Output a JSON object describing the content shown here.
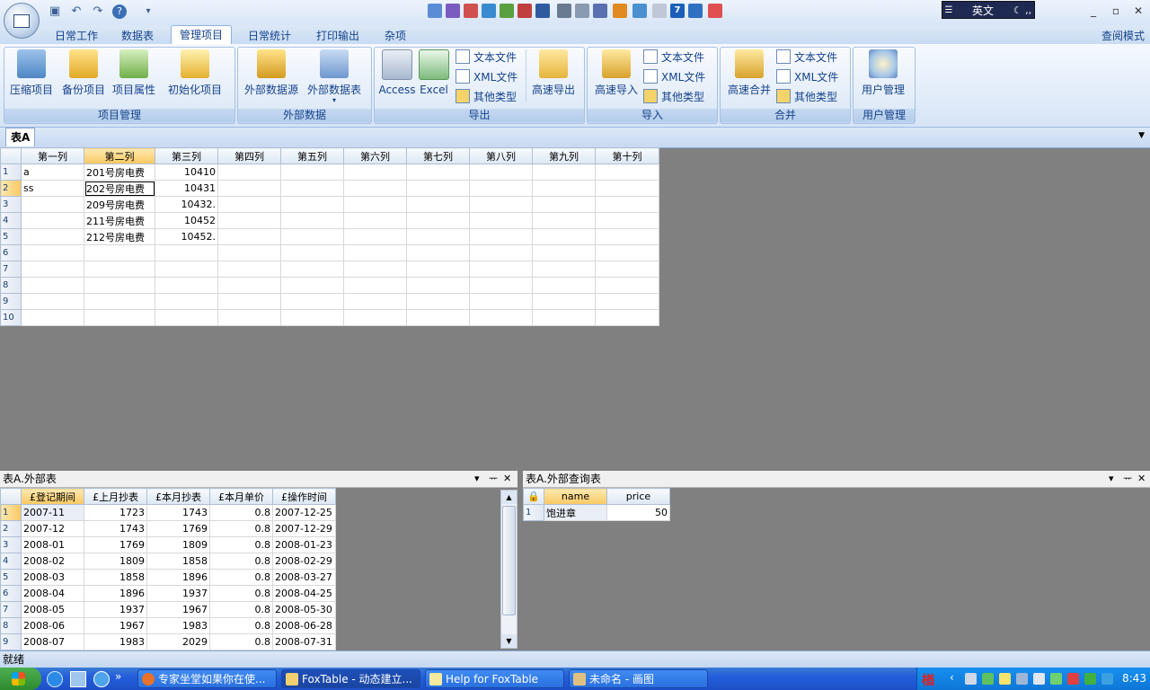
{
  "app": {
    "tabs": [
      "日常工作",
      "数据表",
      "管理项目",
      "日常统计",
      "打印输出",
      "杂项"
    ],
    "active_tab": "管理项目",
    "view_mode": "查阅模式",
    "ime_label": "英文"
  },
  "ribbon": {
    "groups": [
      {
        "label": "项目管理",
        "buttons": [
          "压缩项目",
          "备份项目",
          "项目属性",
          "初始化项目"
        ]
      },
      {
        "label": "外部数据",
        "buttons": [
          "外部数据源",
          "外部数据表"
        ]
      },
      {
        "label": "导出",
        "buttons": [
          "Access",
          "Excel",
          "高速导出"
        ],
        "small": [
          "文本文件",
          "XML文件",
          "其他类型"
        ]
      },
      {
        "label": "导入",
        "buttons": [
          "高速导入"
        ],
        "small": [
          "文本文件",
          "XML文件",
          "其他类型"
        ]
      },
      {
        "label": "合并",
        "buttons": [
          "高速合并"
        ],
        "small": [
          "文本文件",
          "XML文件",
          "其他类型"
        ]
      },
      {
        "label": "用户管理",
        "buttons": [
          "用户管理"
        ]
      }
    ]
  },
  "doc_tab": "表A",
  "main_grid": {
    "columns": [
      "第一列",
      "第二列",
      "第三列",
      "第四列",
      "第五列",
      "第六列",
      "第七列",
      "第八列",
      "第九列",
      "第十列"
    ],
    "rows": [
      [
        "1",
        "a",
        "201号房电费",
        "10410"
      ],
      [
        "2",
        "ss",
        "202号房电费",
        "10431"
      ],
      [
        "3",
        "",
        "209号房电费",
        "10432."
      ],
      [
        "4",
        "",
        "211号房电费",
        "10452"
      ],
      [
        "5",
        "",
        "212号房电费",
        "10452."
      ],
      [
        "6",
        "",
        "",
        ""
      ],
      [
        "7",
        "",
        "",
        ""
      ],
      [
        "8",
        "",
        "",
        ""
      ],
      [
        "9",
        "",
        "",
        ""
      ],
      [
        "10",
        "",
        "",
        ""
      ]
    ]
  },
  "left_panel": {
    "title": "表A.外部表",
    "columns": [
      "£登记期间",
      "£上月抄表",
      "£本月抄表",
      "£本月单价",
      "£操作时间"
    ],
    "rows": [
      [
        "1",
        "2007-11",
        "1723",
        "1743",
        "0.8",
        "2007-12-25"
      ],
      [
        "2",
        "2007-12",
        "1743",
        "1769",
        "0.8",
        "2007-12-29"
      ],
      [
        "3",
        "2008-01",
        "1769",
        "1809",
        "0.8",
        "2008-01-23"
      ],
      [
        "4",
        "2008-02",
        "1809",
        "1858",
        "0.8",
        "2008-02-29"
      ],
      [
        "5",
        "2008-03",
        "1858",
        "1896",
        "0.8",
        "2008-03-27"
      ],
      [
        "6",
        "2008-04",
        "1896",
        "1937",
        "0.8",
        "2008-04-25"
      ],
      [
        "7",
        "2008-05",
        "1937",
        "1967",
        "0.8",
        "2008-05-30"
      ],
      [
        "8",
        "2008-06",
        "1967",
        "1983",
        "0.8",
        "2008-06-28"
      ],
      [
        "9",
        "2008-07",
        "1983",
        "2029",
        "0.8",
        "2008-07-31"
      ]
    ]
  },
  "right_panel": {
    "title": "表A.外部查询表",
    "columns": [
      "name",
      "price"
    ],
    "rows": [
      [
        "1",
        "饱进章",
        "50"
      ]
    ]
  },
  "status": "就绪",
  "taskbar": {
    "items": [
      "专家坐堂如果你在使...",
      "FoxTable - 动态建立...",
      "Help for FoxTable",
      "未命名 - 画图"
    ],
    "clock": "8:43",
    "tray_text": "楢"
  }
}
